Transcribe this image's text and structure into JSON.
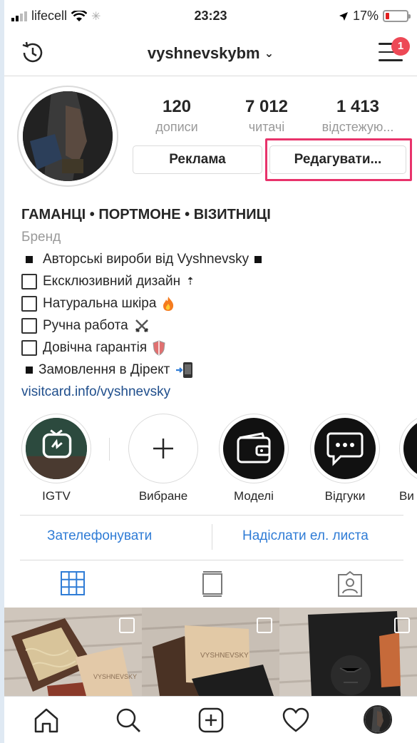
{
  "status_bar": {
    "carrier": "lifecell",
    "time": "23:23",
    "battery": "17%"
  },
  "header": {
    "username": "vyshnevskybm",
    "notifications_count": "1"
  },
  "stats": [
    {
      "value": "120",
      "label": "дописи"
    },
    {
      "value": "7 012",
      "label": "читачі"
    },
    {
      "value": "1 413",
      "label": "відстежую..."
    }
  ],
  "buttons": {
    "ads": "Реклама",
    "edit": "Редагувати..."
  },
  "bio": {
    "name": "ГАМАНЦІ • ПОРТМОНЕ • ВІЗИТНИЦІ",
    "category": "Бренд",
    "lines": [
      "Авторські вироби від Vyshnevsky",
      "Ексклюзивний дизайн",
      "Натуральна шкіра",
      "Ручна работа",
      "Довічна гарантія",
      "Замовлення в Дірект"
    ],
    "link": "visitcard.info/vyshnevsky"
  },
  "highlights": [
    {
      "label": "IGTV",
      "icon": "igtv-icon"
    },
    {
      "label": "Вибране",
      "icon": "plus-icon"
    },
    {
      "label": "Моделі",
      "icon": "wallet-icon"
    },
    {
      "label": "Відгуки",
      "icon": "chat-bubble-icon"
    },
    {
      "label": "Ви",
      "icon": "partial-icon"
    }
  ],
  "contact": {
    "call": "Зателефонувати",
    "email": "Надіслати ел. листа"
  },
  "grid_brand": "VYSHNEVSKY",
  "colors": {
    "accent_blue": "#2f7cd6",
    "highlight_pink": "#e8336b",
    "badge_red": "#ed4956"
  }
}
